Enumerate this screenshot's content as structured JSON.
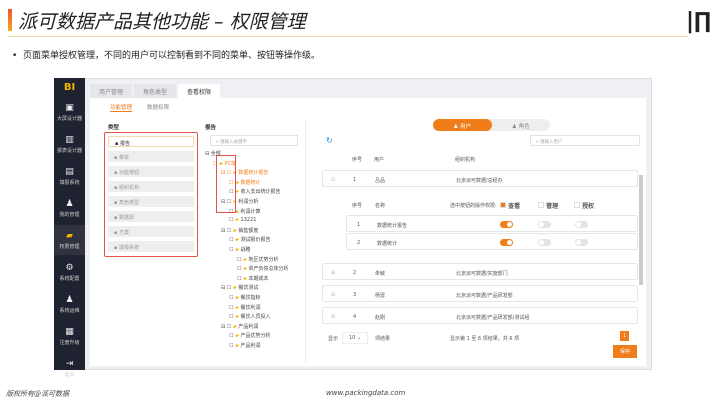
{
  "slide": {
    "title": "派可数据产品其他功能 – 权限管理",
    "logo": "派",
    "bullet": "页面菜单授权管理，不同的用户可以控制看到不同的菜单、按钮等操作级。",
    "footer_left": "版权所有@派可数据",
    "footer_center": "www.packingdata.com"
  },
  "sidebar": {
    "brand": "BI",
    "items": [
      {
        "label": "大屏设计器",
        "icon": "▣"
      },
      {
        "label": "报表设计器",
        "icon": "▥"
      },
      {
        "label": "填报系统",
        "icon": "▤"
      },
      {
        "label": "我的管理",
        "icon": "♟"
      },
      {
        "label": "权限管理",
        "icon": "▰"
      },
      {
        "label": "系统配置",
        "icon": "⚙"
      },
      {
        "label": "系统运维",
        "icon": "♟"
      },
      {
        "label": "注册升级",
        "icon": "▦"
      },
      {
        "label": "退出",
        "icon": "⇥"
      }
    ]
  },
  "tabs": [
    "用户管理",
    "角色类型",
    "查看权限"
  ],
  "subtabs": [
    "功能管理",
    "数据权限"
  ],
  "type_panel": {
    "label": "类型",
    "items": [
      "报告",
      "菜单",
      "功能按钮",
      "组织机构",
      "角色类型",
      "数据源",
      "方案",
      "填报系统"
    ]
  },
  "tree": {
    "label": "报告",
    "search_placeholder": "请输入关键字",
    "nodes": [
      {
        "t": "全部",
        "d": 0
      },
      {
        "t": "PC端",
        "d": 1
      },
      {
        "t": "数据统计报告",
        "d": 2
      },
      {
        "t": "数据统计",
        "d": 3
      },
      {
        "t": "收入支出统计报告",
        "d": 3
      },
      {
        "t": "利润分析",
        "d": 2
      },
      {
        "t": "利润计算",
        "d": 3
      },
      {
        "t": "13221",
        "d": 3
      },
      {
        "t": "销售额度",
        "d": 2
      },
      {
        "t": "测试报价报告",
        "d": 3
      },
      {
        "t": "战略",
        "d": 3
      },
      {
        "t": "地区优势分析",
        "d": 4
      },
      {
        "t": "资产负债总体分析",
        "d": 4
      },
      {
        "t": "本期成本",
        "d": 4
      },
      {
        "t": "餐饮测试",
        "d": 2
      },
      {
        "t": "餐饮指标",
        "d": 3
      },
      {
        "t": "餐饮利润",
        "d": 3
      },
      {
        "t": "餐饮人员投入",
        "d": 3
      },
      {
        "t": "产品利润",
        "d": 2
      },
      {
        "t": "产品优势分析",
        "d": 3
      },
      {
        "t": "产品利润",
        "d": 3
      }
    ]
  },
  "right": {
    "seg": [
      "用户",
      "角色"
    ],
    "search_placeholder": "请输入用户",
    "headers": [
      "序号",
      "用户",
      "组织机构"
    ],
    "users": [
      {
        "no": "1",
        "name": "吕品",
        "org": "北京派可数据/总经办"
      },
      {
        "no": "2",
        "name": "朱敏",
        "org": "北京派可数据/实施部门"
      },
      {
        "no": "3",
        "name": "杨雷",
        "org": "北京派可数据/产品研发部"
      },
      {
        "no": "4",
        "name": "赵刚",
        "org": "北京派可数据/产品研发部/测试组"
      }
    ],
    "sub_headers": [
      "序号",
      "名称",
      "选中按钮的操作权限:",
      "查看",
      "管理",
      "授权"
    ],
    "sub_rows": [
      {
        "no": "1",
        "name": "数据统计报告",
        "view": true,
        "manage": false,
        "grant": false
      },
      {
        "no": "2",
        "name": "数据统计",
        "view": true,
        "manage": false,
        "grant": false
      }
    ],
    "show": "显示",
    "page_size": "10",
    "per": "项结果",
    "summary": "显示第 1 至 6 项结果，共 6 项",
    "page": "1",
    "save": "保存"
  },
  "colors": {
    "accent": "#f07c1a",
    "sidebar": "#1f2230",
    "highlight": "#e0534a"
  }
}
